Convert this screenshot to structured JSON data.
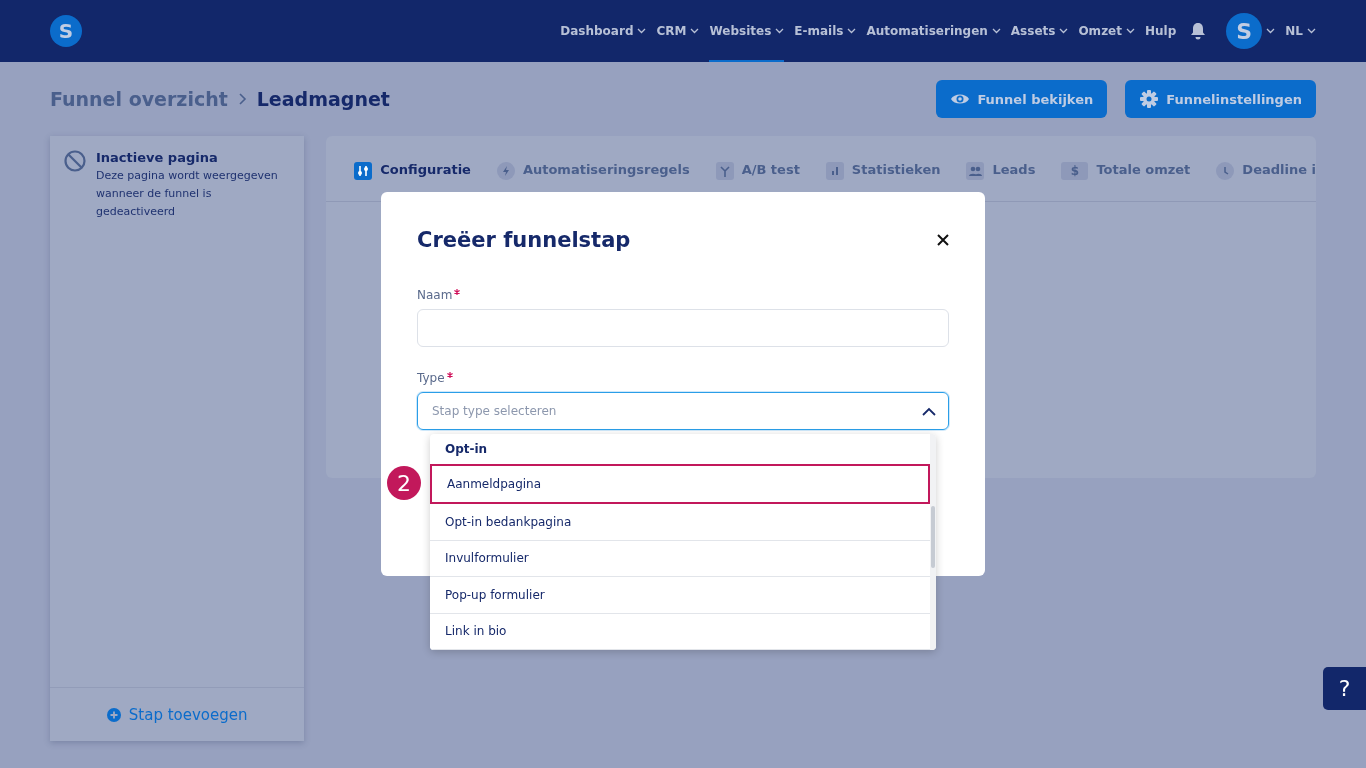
{
  "nav": {
    "logo": "S",
    "items": [
      {
        "label": "Dashboard",
        "dropdown": true,
        "selected": false
      },
      {
        "label": "CRM",
        "dropdown": true,
        "selected": false
      },
      {
        "label": "Websites",
        "dropdown": true,
        "selected": true
      },
      {
        "label": "E-mails",
        "dropdown": true,
        "selected": false
      },
      {
        "label": "Automatiseringen",
        "dropdown": true,
        "selected": false
      },
      {
        "label": "Assets",
        "dropdown": true,
        "selected": false
      },
      {
        "label": "Omzet",
        "dropdown": true,
        "selected": false
      },
      {
        "label": "Hulp",
        "dropdown": false,
        "selected": false
      }
    ],
    "avatar": "S",
    "language": "NL"
  },
  "breadcrumb": [
    "Funnel overzicht",
    "Leadmagnet"
  ],
  "header_buttons": [
    {
      "label": "Funnel bekijken",
      "kind": "eye"
    },
    {
      "label": "Funnelinstellingen",
      "kind": "gear"
    }
  ],
  "sidebar": {
    "page": {
      "title": "Inactieve pagina",
      "description": "Deze pagina wordt weergegeven wanneer de funnel is gedeactiveerd"
    },
    "add_button": "Stap toevoegen"
  },
  "tabs": [
    {
      "label": "Configuratie",
      "kind": "sliders",
      "selected": true
    },
    {
      "label": "Automatiseringsregels",
      "kind": "bolt",
      "selected": false
    },
    {
      "label": "A/B test",
      "kind": "split",
      "selected": false
    },
    {
      "label": "Statistieken",
      "kind": "chart",
      "selected": false
    },
    {
      "label": "Leads",
      "kind": "people",
      "selected": false
    },
    {
      "label": "Totale omzet",
      "kind": "dollar",
      "glyph": "$",
      "selected": false
    },
    {
      "label": "Deadline i",
      "kind": "clock",
      "selected": false
    }
  ],
  "modal": {
    "title": "Creëer funnelstap",
    "fields": [
      {
        "label": "Naam",
        "required": true,
        "kind": "text"
      },
      {
        "label": "Type",
        "required": true,
        "kind": "select",
        "placeholder": "Stap type selecteren",
        "expanded": true
      }
    ],
    "dropdown": {
      "group": "Opt-in",
      "options": [
        {
          "label": "Aanmeldpagina",
          "highlighted": true,
          "marker": "2"
        },
        {
          "label": "Opt-in bedankpagina",
          "highlighted": false
        },
        {
          "label": "Invulformulier",
          "highlighted": false
        },
        {
          "label": "Pop-up formulier",
          "highlighted": false
        },
        {
          "label": "Link in bio",
          "highlighted": false
        }
      ]
    }
  },
  "help_button": "?"
}
